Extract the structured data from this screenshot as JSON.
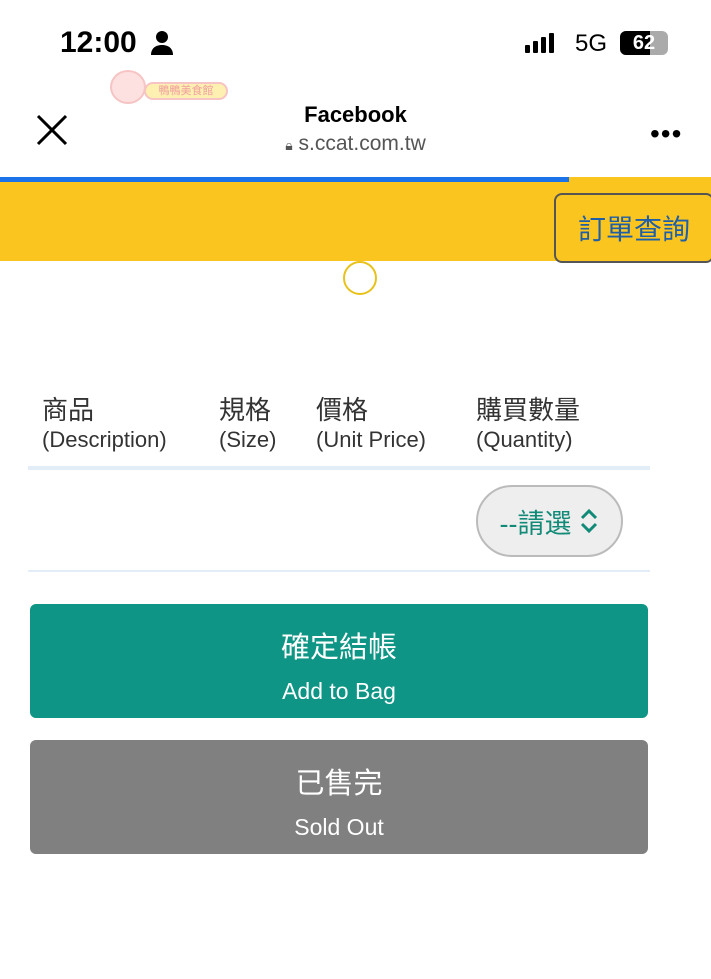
{
  "status_bar": {
    "time": "12:00",
    "network": "5G",
    "battery": "62",
    "battery_level": 0.62
  },
  "browser": {
    "title": "Facebook",
    "url": "s.ccat.com.tw",
    "load_progress": 0.8
  },
  "logo": {
    "text": "鴨鴨美食館"
  },
  "banner": {
    "order_query": "訂單查詢"
  },
  "table": {
    "headers": [
      {
        "zh": "商品",
        "en": "(Description)"
      },
      {
        "zh": "規格",
        "en": "(Size)"
      },
      {
        "zh": "價格",
        "en": "(Unit Price)"
      },
      {
        "zh": "購買數量",
        "en": "(Quantity)"
      }
    ],
    "quantity_select": "--請選"
  },
  "buttons": {
    "add": {
      "zh": "確定結帳",
      "en": "Add to Bag",
      "color": "#0f9585"
    },
    "sold_out": {
      "zh": "已售完",
      "en": "Sold Out",
      "color": "#808080"
    }
  }
}
